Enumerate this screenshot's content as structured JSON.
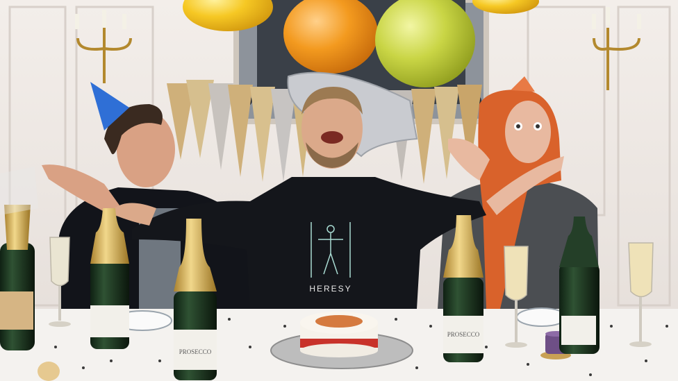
{
  "scene": {
    "shirt_text": "HERESY",
    "bottle_labels": [
      "PROSECCO",
      "PROSECCO"
    ]
  },
  "colors": {
    "wall": "#ece6e2",
    "table": "#f4f2ef",
    "balloon_yellow": "#f6c824",
    "balloon_orange": "#f39a1f",
    "balloon_green": "#c9d545",
    "party_hat_blue": "#2f6fd6",
    "party_hat_orange": "#e87a45",
    "hair_orange": "#d9622b",
    "bottle_green": "#1f3a24",
    "foil_gold": "#d8b35c",
    "cake_ribbon": "#c8322a"
  }
}
